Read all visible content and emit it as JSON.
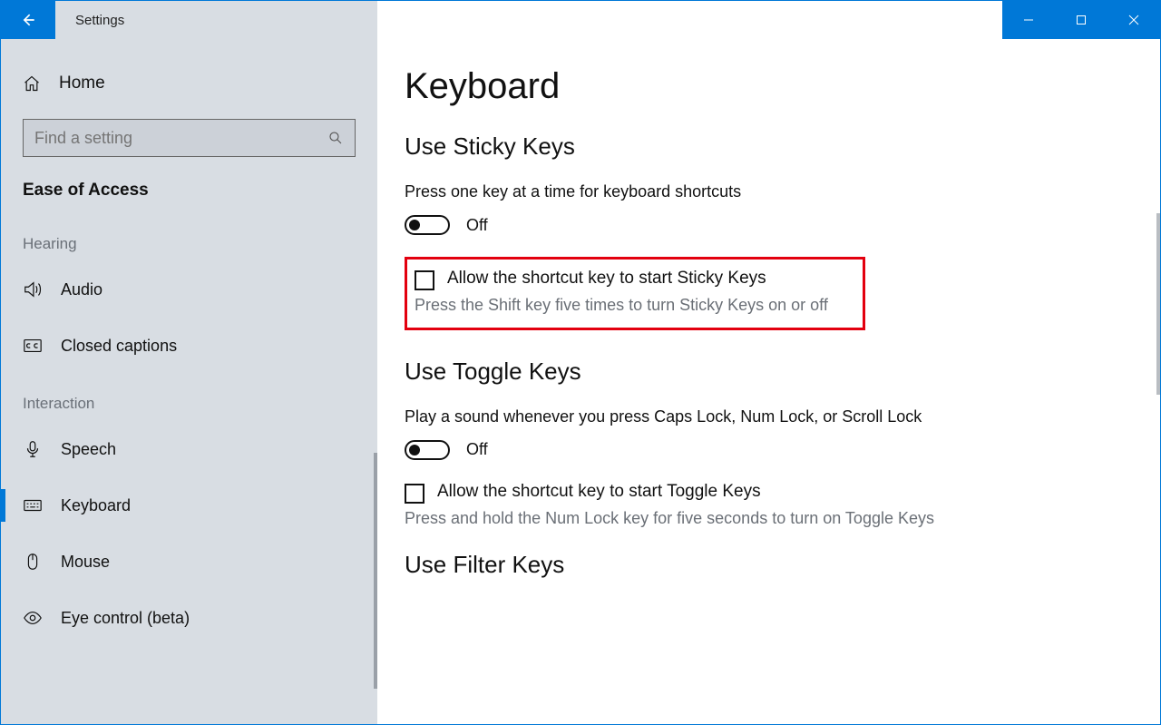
{
  "titlebar": {
    "title": "Settings"
  },
  "sidebar": {
    "home": "Home",
    "search_placeholder": "Find a setting",
    "category": "Ease of Access",
    "groups": [
      {
        "label": "Hearing",
        "items": [
          {
            "id": "audio",
            "label": "Audio"
          },
          {
            "id": "closed-captions",
            "label": "Closed captions"
          }
        ]
      },
      {
        "label": "Interaction",
        "items": [
          {
            "id": "speech",
            "label": "Speech"
          },
          {
            "id": "keyboard",
            "label": "Keyboard",
            "active": true
          },
          {
            "id": "mouse",
            "label": "Mouse"
          },
          {
            "id": "eye-control",
            "label": "Eye control (beta)"
          }
        ]
      }
    ]
  },
  "main": {
    "title": "Keyboard",
    "sticky": {
      "heading": "Use Sticky Keys",
      "desc": "Press one key at a time for keyboard shortcuts",
      "toggle_state": "Off",
      "shortcut_label": "Allow the shortcut key to start Sticky Keys",
      "shortcut_hint": "Press the Shift key five times to turn Sticky Keys on or off"
    },
    "toggle_keys": {
      "heading": "Use Toggle Keys",
      "desc": "Play a sound whenever you press Caps Lock, Num Lock, or Scroll Lock",
      "toggle_state": "Off",
      "shortcut_label": "Allow the shortcut key to start Toggle Keys",
      "shortcut_hint": "Press and hold the Num Lock key for five seconds to turn on Toggle Keys"
    },
    "filter": {
      "heading": "Use Filter Keys"
    }
  }
}
